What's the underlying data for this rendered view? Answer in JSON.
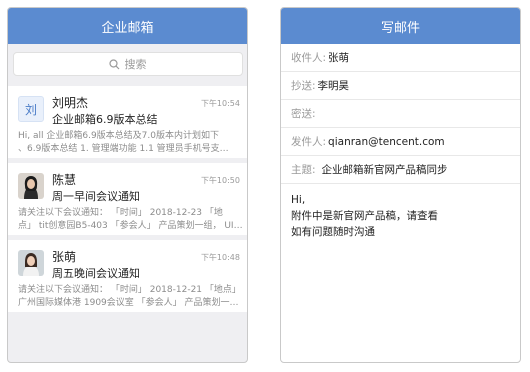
{
  "left": {
    "title": "企业邮箱",
    "search_placeholder": "搜索",
    "mails": [
      {
        "avatar_text": "刘",
        "avatar_type": "letter",
        "sender": "刘明杰",
        "time": "下午10:54",
        "subject": "企业邮箱6.9版本总结",
        "preview1": "Hi, all 企业邮箱6.9版本总结及7.0版本内计划如下",
        "preview2": "、6.9版本总结 1. 管理端功能 1.1 管理员手机号支…"
      },
      {
        "avatar_type": "photo",
        "sender": "陈慧",
        "time": "下午10:50",
        "subject": "周一早间会议通知",
        "preview1": "请关注以下会议通知： 「时间」 2018-12-23 「地",
        "preview2": "点」 tit创意园B5-403 「参会人」 产品策划一组， UI…"
      },
      {
        "avatar_type": "photo",
        "sender": "张萌",
        "time": "下午10:48",
        "subject": "周五晚间会议通知",
        "preview1": "请关注以下会议通知： 「时间」 2018-12-21 「地点」",
        "preview2": "广州国际媒体港 1909会议室 「参会人」 产品策划一…"
      }
    ]
  },
  "right": {
    "title": "写邮件",
    "to_label": "收件人:",
    "to_value": "张萌",
    "cc_label": "抄送:",
    "cc_value": "李明昊",
    "bcc_label": "密送:",
    "from_label": "发件人:",
    "from_value": "qianran@tencent.com",
    "subject_label": "主题:",
    "subject_value": "企业邮箱新官网产品稿同步",
    "body_line1": "Hi,",
    "body_line2": "附件中是新官网产品稿，请查看",
    "body_line3": "如有问题随时沟通"
  },
  "colors": {
    "accent": "#5b8bd0",
    "background": "#efeff2"
  }
}
